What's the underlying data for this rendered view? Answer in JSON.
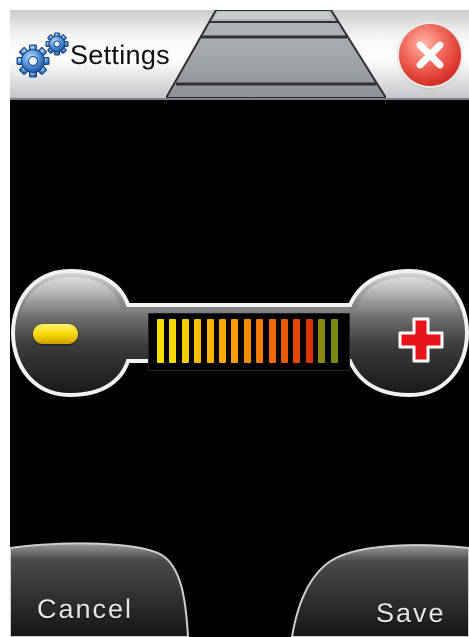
{
  "header": {
    "title": "Settings",
    "icon": "gear-icon",
    "close_icon": "close-icon"
  },
  "volume": {
    "decrease_icon": "minus-icon",
    "increase_icon": "plus-icon",
    "level_total_bars": 15,
    "level_filled_bars": 13,
    "bar_colors": [
      "#f5e000",
      "#f6d600",
      "#f7cb00",
      "#f8c000",
      "#f9b400",
      "#f9a700",
      "#f89a00",
      "#f58c00",
      "#f27d00",
      "#ee6c00",
      "#e85a00",
      "#e04800",
      "#d83500",
      "#8a8a10",
      "#7a8a10"
    ]
  },
  "footer": {
    "cancel_label": "Cancel",
    "save_label": "Save"
  },
  "colors": {
    "background": "#000000",
    "minus": "#f7d300",
    "plus": "#e8141a",
    "close": "#d9342a"
  }
}
